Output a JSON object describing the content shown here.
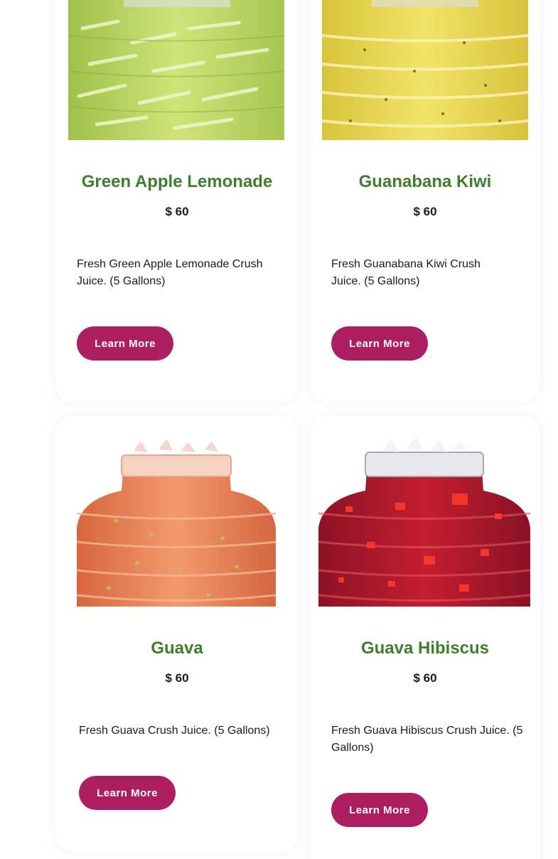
{
  "products": [
    {
      "title": "Green Apple Lemonade",
      "price": "$ 60",
      "description": "Fresh Green Apple Lemonade Crush Juice. (5 Gallons)",
      "button_label": "Learn More",
      "image_icon": "juice-jar-green-apple-lemonade"
    },
    {
      "title": "Guanabana Kiwi",
      "price": "$ 60",
      "description": "Fresh Guanabana Kiwi Crush Juice. (5 Gallons)",
      "button_label": "Learn More",
      "image_icon": "juice-jar-guanabana-kiwi"
    },
    {
      "title": "Guava",
      "price": "$ 60",
      "description": "Fresh Guava Crush Juice. (5 Gallons)",
      "button_label": "Learn More",
      "image_icon": "juice-jar-guava"
    },
    {
      "title": "Guava Hibiscus",
      "price": "$ 60",
      "description": "Fresh Guava Hibiscus Crush Juice. (5 Gallons)",
      "button_label": "Learn More",
      "image_icon": "juice-jar-guava-hibiscus"
    }
  ],
  "colors": {
    "title": "#3f7f2c",
    "button": "#ae1f62",
    "text": "#1c1c1c"
  }
}
